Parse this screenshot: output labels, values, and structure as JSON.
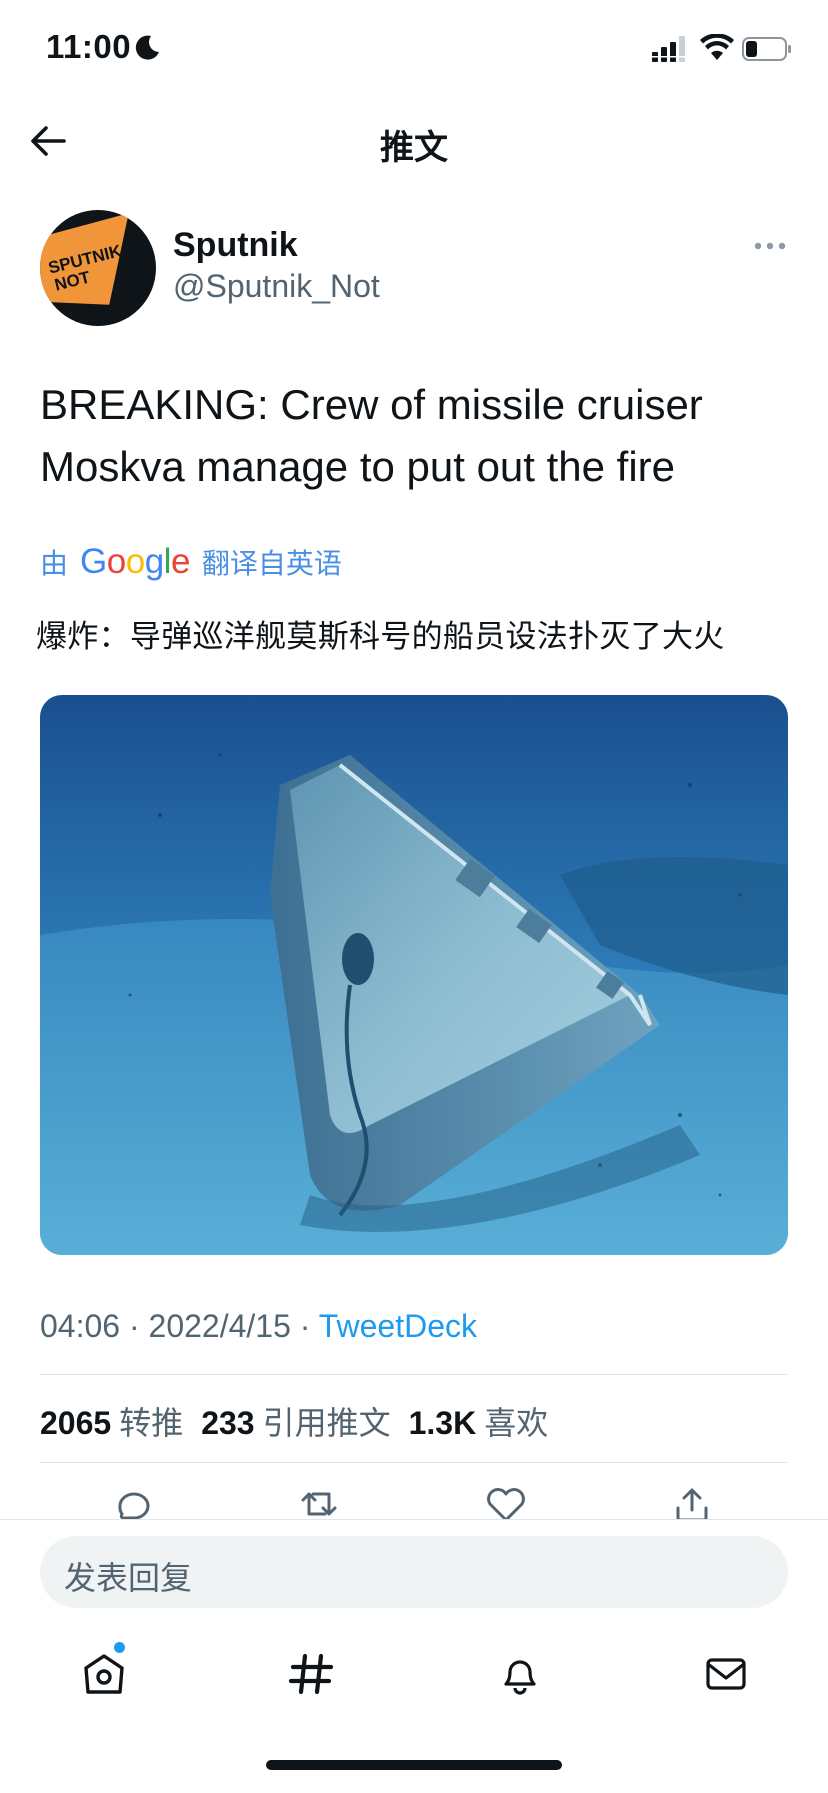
{
  "status_bar": {
    "time": "11:00"
  },
  "header": {
    "title": "推文"
  },
  "author": {
    "name": "Sputnik",
    "handle": "@Sputnik_Not",
    "avatar_text": [
      "SPUTNIK",
      "NOT"
    ]
  },
  "tweet": {
    "text_line1": "BREAKING: Crew of missile cruiser",
    "text_line2": "Moskva manage to put out the fire",
    "translation": {
      "prefix": "由",
      "brand": "Google",
      "suffix": "翻译自英语",
      "text": "爆炸：导弹巡洋舰莫斯科号的船员设法扑灭了大火"
    },
    "time": "04:06",
    "date": "2022/4/15",
    "separator": "·",
    "source": "TweetDeck"
  },
  "stats": [
    {
      "count": "2065",
      "label": "转推"
    },
    {
      "count": "233",
      "label": "引用推文"
    },
    {
      "count": "1.3K",
      "label": "喜欢"
    }
  ],
  "composer": {
    "placeholder": "发表回复"
  },
  "colors": {
    "accent": "#1d9bf0",
    "text": "#0f1419",
    "muted": "#536471",
    "avatar_orange": "#f0953a"
  },
  "icons": {
    "back": "arrow-left-icon",
    "more": "more-horizontal-icon",
    "reply": "reply-icon",
    "retweet": "retweet-icon",
    "like": "heart-icon",
    "share": "share-icon",
    "nav": [
      "home-icon",
      "explore-hashtag-icon",
      "notifications-icon",
      "messages-icon"
    ]
  }
}
